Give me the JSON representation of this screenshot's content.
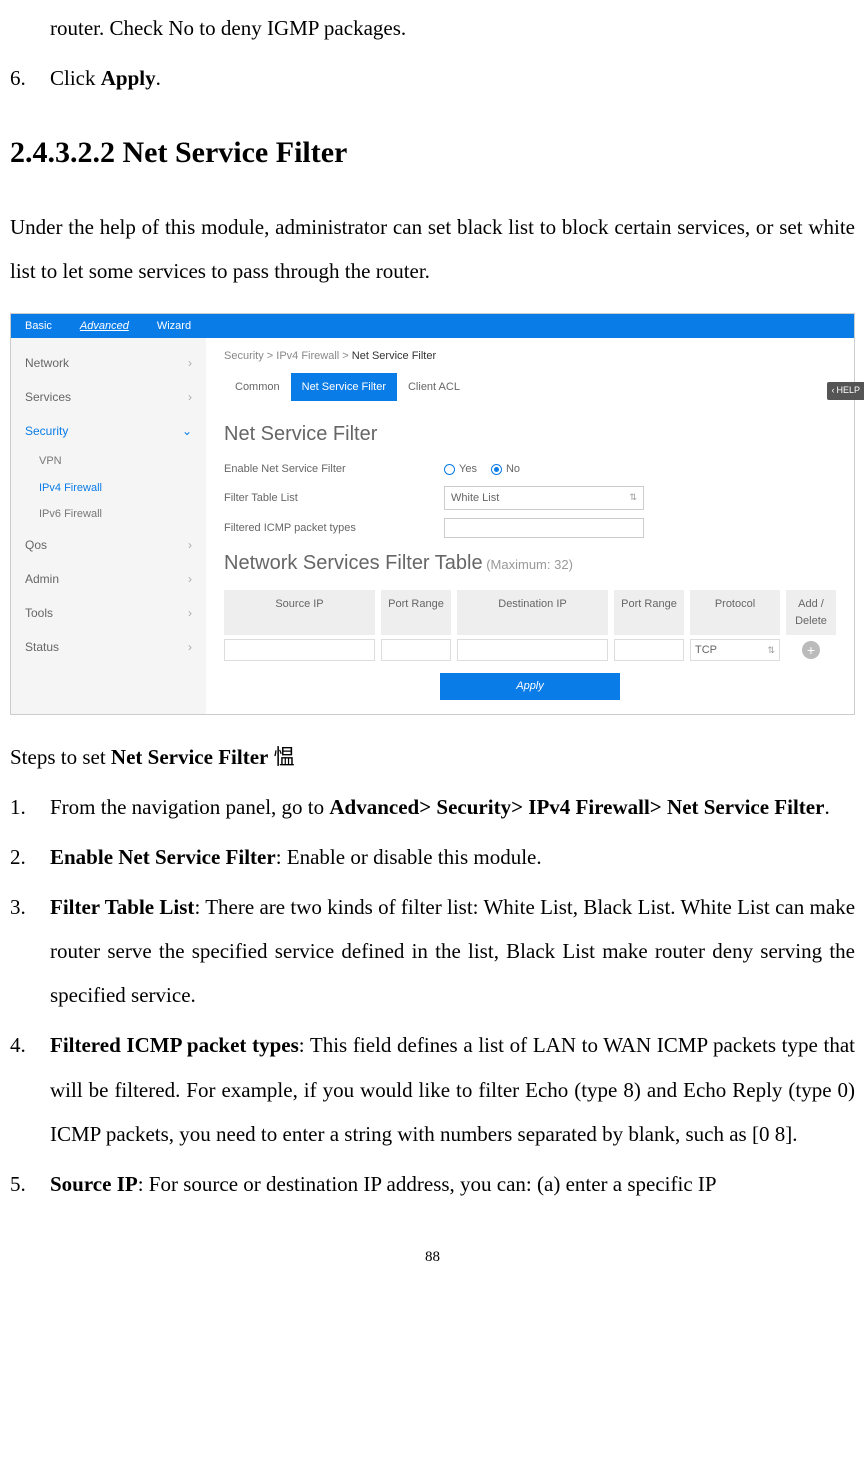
{
  "doc": {
    "pre_line": "router. Check No to deny IGMP packages.",
    "list6_num": "6.",
    "list6_body_a": "Click ",
    "list6_body_b": "Apply",
    "list6_body_c": ".",
    "heading": "2.4.3.2.2 Net Service Filter",
    "intro": "Under the help of this module, administrator can set black list to block certain services, or set white list to let some services to pass through the router.",
    "steps_intro_a": "Steps to set ",
    "steps_intro_b": "Net Service Filter",
    "steps_intro_c": " 愠",
    "step1_num": "1.",
    "step1_a": "From the navigation panel, go to ",
    "step1_b": "Advanced> Security> IPv4 Firewall> Net Service Filter",
    "step1_c": ".",
    "step2_num": "2.",
    "step2_a": "Enable Net Service Filter",
    "step2_b": ": Enable or disable this module.",
    "step3_num": "3.",
    "step3_a": "Filter Table List",
    "step3_b": ": There are two kinds of filter list: White List, Black List. White List can make router serve the specified service defined in the list, Black List make router deny serving the specified service.",
    "step4_num": "4.",
    "step4_a": "Filtered ICMP packet types",
    "step4_b": ": This field defines a list of LAN to WAN ICMP packets type that will be filtered. For example, if you would like to filter Echo (type 8) and Echo Reply (type 0) ICMP packets, you need to enter a string with numbers separated by blank, such as [0 8].",
    "step5_num": "5.",
    "step5_a": "Source IP",
    "step5_b": ": For source or destination IP address, you can: (a) enter a specific IP",
    "page_number": "88"
  },
  "ui": {
    "tabs": {
      "basic": "Basic",
      "advanced": "Advanced",
      "wizard": "Wizard"
    },
    "sidebar": {
      "network": "Network",
      "services": "Services",
      "security": "Security",
      "vpn": "VPN",
      "ipv4": "IPv4 Firewall",
      "ipv6": "IPv6 Firewall",
      "qos": "Qos",
      "admin": "Admin",
      "tools": "Tools",
      "status": "Status"
    },
    "breadcrumb": {
      "a": "Security > IPv4 Firewall > ",
      "b": "Net Service Filter"
    },
    "subtabs": {
      "common": "Common",
      "nsf": "Net Service Filter",
      "acl": "Client ACL"
    },
    "help": "HELP",
    "section1": "Net Service Filter",
    "form": {
      "enable_label": "Enable Net Service Filter",
      "yes": "Yes",
      "no": "No",
      "filter_table_label": "Filter Table List",
      "filter_table_value": "White List",
      "icmp_label": "Filtered ICMP packet types"
    },
    "section2": "Network Services Filter Table",
    "section2_max": " (Maximum: 32)",
    "table": {
      "src_ip": "Source IP",
      "port_range": "Port Range",
      "dst_ip": "Destination IP",
      "port_range2": "Port Range",
      "protocol": "Protocol",
      "add_del": "Add / Delete",
      "proto_value": "TCP"
    },
    "apply": "Apply"
  }
}
